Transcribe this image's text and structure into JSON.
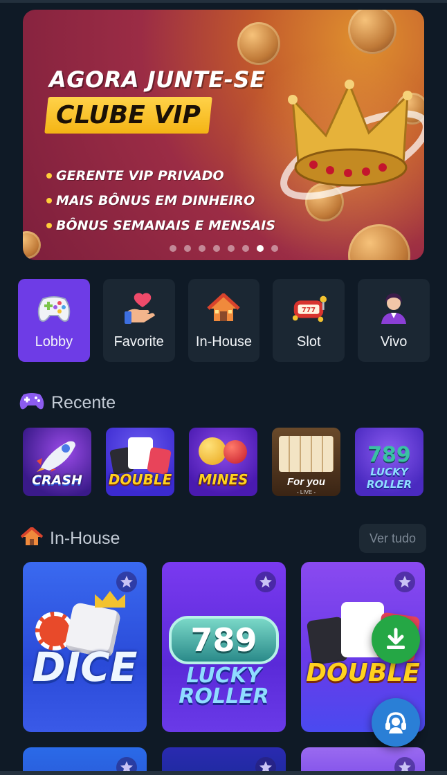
{
  "banner": {
    "title": "AGORA JUNTE-SE",
    "tag": "CLUBE VIP",
    "bullets": [
      "GERENTE VIP PRIVADO",
      "MAIS BÔNUS EM DINHEIRO",
      "BÔNUS SEMANAIS E MENSAIS"
    ],
    "slide_count": 8,
    "active_slide": 7
  },
  "tabs": [
    {
      "label": "Lobby",
      "icon": "gamepad-icon",
      "active": true
    },
    {
      "label": "Favorite",
      "icon": "heart-hand-icon",
      "active": false
    },
    {
      "label": "In-House",
      "icon": "house-icon",
      "active": false
    },
    {
      "label": "Slot",
      "icon": "slot-machine-icon",
      "active": false
    },
    {
      "label": "Vivo",
      "icon": "live-dealer-icon",
      "active": false
    }
  ],
  "recent": {
    "title": "Recente",
    "games": [
      {
        "name": "CRASH"
      },
      {
        "name": "DOUBLE"
      },
      {
        "name": "MINES"
      },
      {
        "name": "For you",
        "sub": "- LIVE -"
      },
      {
        "name": "LUCKY ROLLER",
        "num": "789"
      }
    ]
  },
  "inhouse": {
    "title": "In-House",
    "see_all": "Ver tudo",
    "games": [
      {
        "name": "DICE"
      },
      {
        "name": "LUCKY ROLLER",
        "num": "789"
      },
      {
        "name": "DOUBLE"
      }
    ]
  },
  "colors": {
    "background": "#0f1a26",
    "tab_active": "#6e3ce6",
    "tab_idle": "#1b2733",
    "download_fab": "#25a745",
    "support_fab": "#2a7fd6"
  }
}
